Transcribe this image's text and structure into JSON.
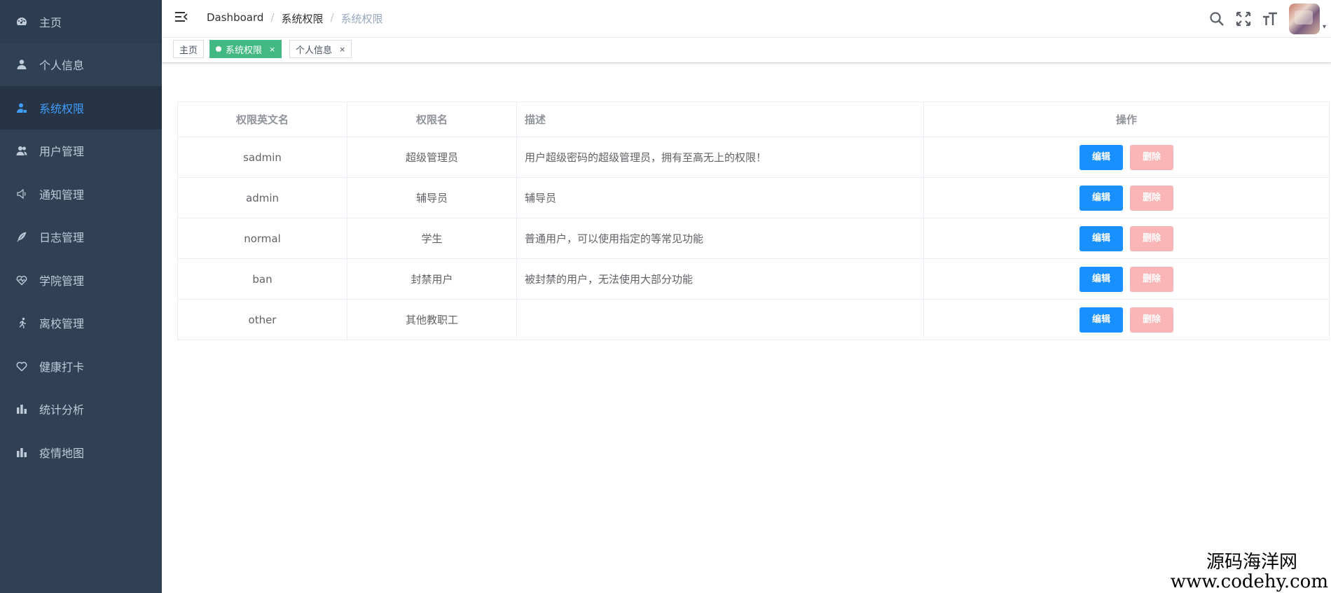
{
  "sidebar": {
    "items": [
      {
        "label": "主页",
        "icon": "dashboard-icon"
      },
      {
        "label": "个人信息",
        "icon": "user-icon"
      },
      {
        "label": "系统权限",
        "icon": "user-lock-icon",
        "active": true
      },
      {
        "label": "用户管理",
        "icon": "users-icon"
      },
      {
        "label": "通知管理",
        "icon": "speaker-icon"
      },
      {
        "label": "日志管理",
        "icon": "feather-icon"
      },
      {
        "label": "学院管理",
        "icon": "heart-pulse-icon"
      },
      {
        "label": "离校管理",
        "icon": "runner-icon"
      },
      {
        "label": "健康打卡",
        "icon": "heart-icon"
      },
      {
        "label": "统计分析",
        "icon": "bar-chart-icon"
      },
      {
        "label": "疫情地图",
        "icon": "bar-chart-icon"
      }
    ]
  },
  "navbar": {
    "breadcrumb": [
      "Dashboard",
      "系统权限",
      "系统权限"
    ],
    "separator": "/"
  },
  "tags": [
    {
      "label": "主页",
      "active": false
    },
    {
      "label": "系统权限",
      "active": true,
      "close": "×"
    },
    {
      "label": "个人信息",
      "active": false,
      "close": "×"
    }
  ],
  "table": {
    "headers": [
      "权限英文名",
      "权限名",
      "描述",
      "操作"
    ],
    "rows": [
      {
        "en": "sadmin",
        "name": "超级管理员",
        "desc": "用户超级密码的超级管理员，拥有至高无上的权限！"
      },
      {
        "en": "admin",
        "name": "辅导员",
        "desc": "辅导员"
      },
      {
        "en": "normal",
        "name": "学生",
        "desc": "普通用户，可以使用指定的等常见功能"
      },
      {
        "en": "ban",
        "name": "封禁用户",
        "desc": "被封禁的用户，无法使用大部分功能"
      },
      {
        "en": "other",
        "name": "其他教职工",
        "desc": ""
      }
    ],
    "edit_label": "编辑",
    "delete_label": "删除"
  },
  "watermark": {
    "line1": "源码海洋网",
    "line2": "www.codehy.com"
  },
  "colors": {
    "sidebar_bg": "#304156",
    "active_menu": "#409eff",
    "tag_active": "#42b983",
    "edit_btn": "#1890ff",
    "delete_btn": "#fab6b6"
  }
}
